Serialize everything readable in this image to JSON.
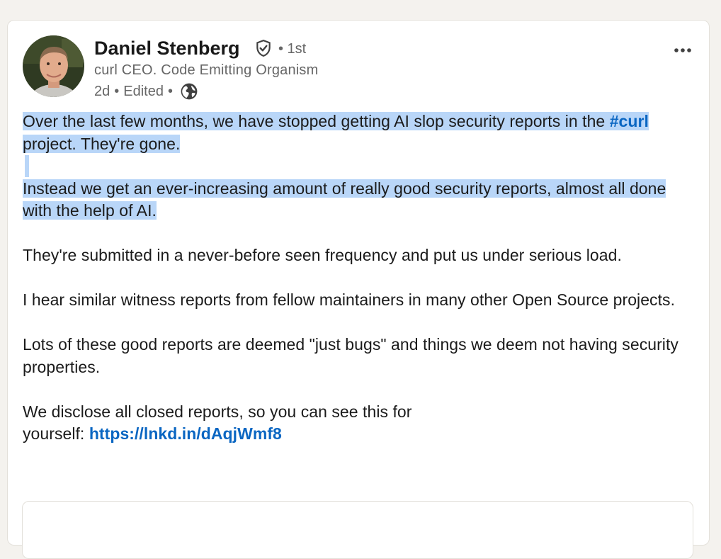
{
  "post": {
    "actor": {
      "name": "Daniel Stenberg",
      "degree": "• 1st",
      "headline": "curl CEO. Code Emitting Organism",
      "time": "2d",
      "edited": "Edited",
      "sep": "•",
      "visibility_icon": "globe-icon",
      "verified_icon": "verified-shield-icon"
    },
    "menu_icon": "more-horizontal-icon",
    "body": {
      "p1_part1": "Over the last few months, we have stopped getting AI slop security reports in the ",
      "p1_hashtag": "#curl",
      "p1_part2": " project. They're gone.",
      "p2": "Instead we get an ever-increasing amount of really good security reports, almost all done with the help of AI.",
      "p3": "They're submitted in a never-before seen frequency and put us under serious load.",
      "p4": "I hear similar witness reports from fellow maintainers in many other Open Source projects.",
      "p5": "Lots of these good reports are deemed \"just bugs\" and things we deem not having security properties.",
      "p6_line1": "We disclose all closed reports, so you can see this for",
      "p6_prefix": "yourself: ",
      "p6_link": "https://lnkd.in/dAqjWmf8"
    },
    "colors": {
      "link": "#0a66c2",
      "selection": "#b9d6f8",
      "secondary_text": "#666666",
      "background": "#f4f2ee"
    }
  }
}
